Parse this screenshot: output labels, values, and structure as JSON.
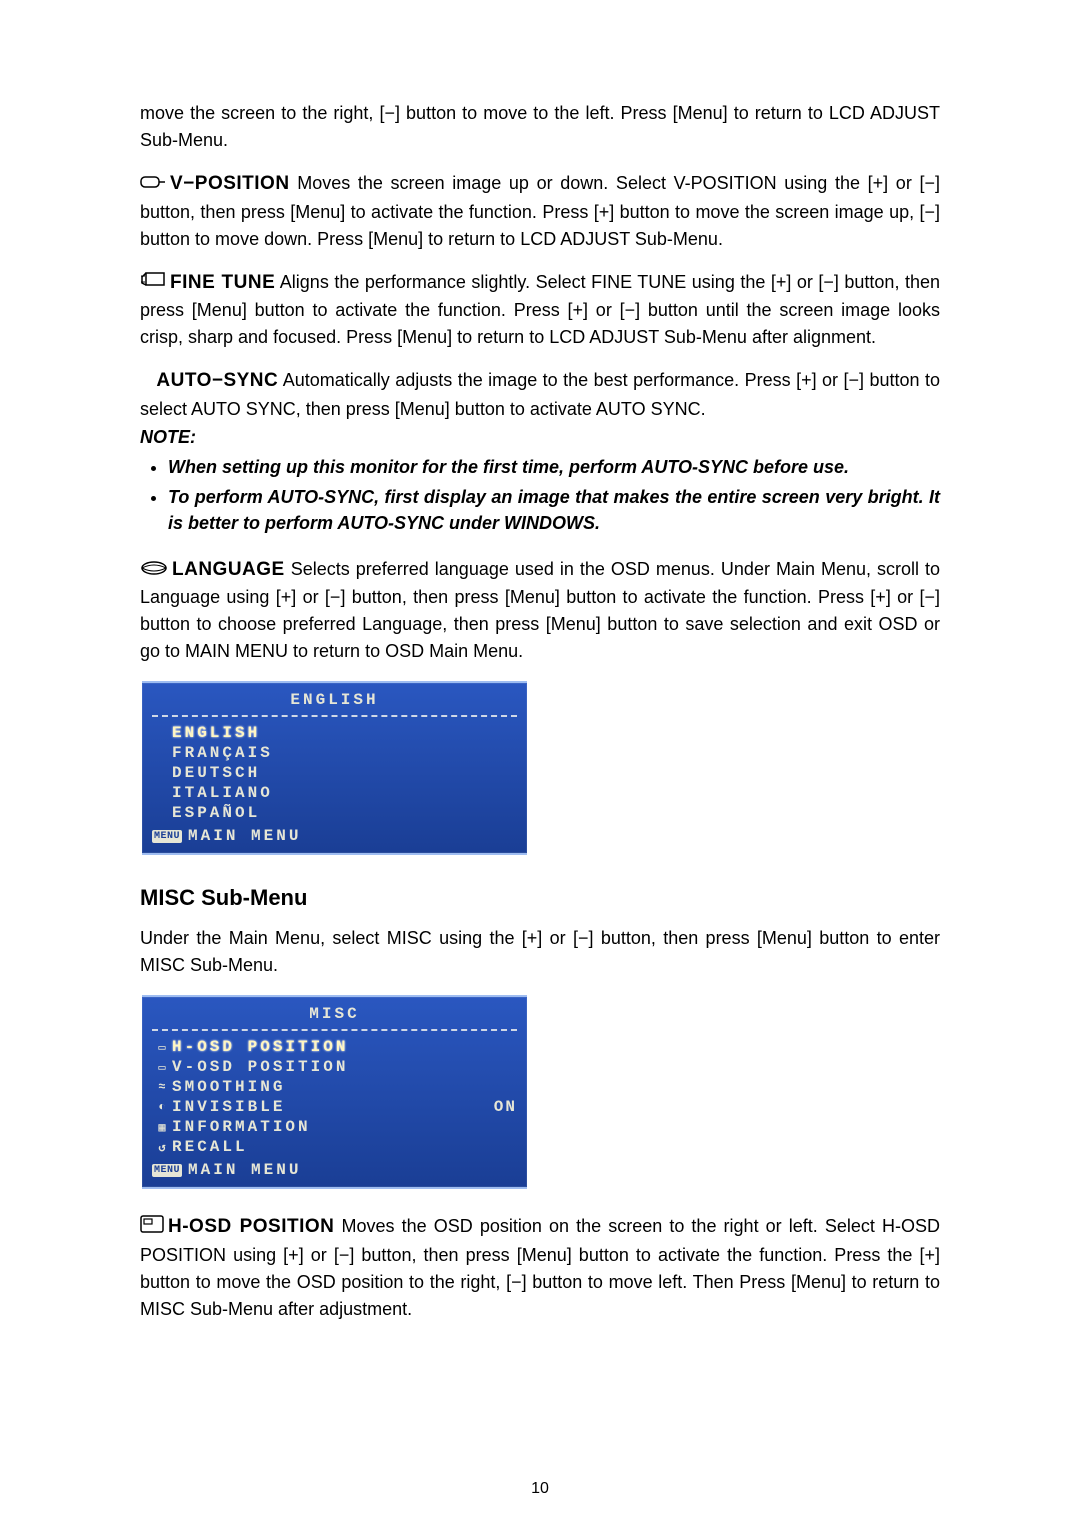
{
  "top_continuation": "move the screen to the right, [−] button to move to the left. Press [Menu] to return to LCD ADJUST Sub-Menu.",
  "vposition": {
    "title": "V−POSITION",
    "desc": "Moves the screen image up or down. Select V-POSITION using the [+] or [−] button, then press [Menu] to activate the function. Press [+] button to move the screen image up, [−] button to move down. Press [Menu] to return to LCD ADJUST Sub-Menu."
  },
  "finetune": {
    "title": "FINE TUNE",
    "desc": "Aligns the performance slightly. Select FINE TUNE using the [+] or [−] button, then press [Menu] button to activate the function. Press [+] or [−] button until the screen image looks crisp, sharp and focused. Press [Menu] to return to LCD ADJUST Sub-Menu after alignment."
  },
  "autosync": {
    "title": "AUTO−SYNC",
    "desc": "Automatically adjusts the image to the best performance. Press [+] or [−] button to select AUTO SYNC, then press [Menu] button to activate AUTO SYNC."
  },
  "note_label": "NOTE:",
  "notes": [
    "When setting up this monitor for the first time, perform AUTO-SYNC before use.",
    "To perform AUTO-SYNC, first display an image that makes the entire screen very bright. It is better to perform AUTO-SYNC under WINDOWS."
  ],
  "language": {
    "title": "LANGUAGE",
    "desc": "Selects preferred language used in the OSD menus. Under Main Menu, scroll to Language using [+] or [−] button, then press [Menu] button to activate the function. Press [+] or [−] button to choose preferred Language, then press [Menu] button to save selection and exit OSD or go to MAIN MENU to return to OSD Main Menu."
  },
  "osd_language": {
    "title": "ENGLISH",
    "options": [
      "ENGLISH",
      "FRANÇAIS",
      "DEUTSCH",
      "ITALIANO",
      "ESPAÑOL"
    ],
    "footer_tag": "MENU",
    "footer": "MAIN MENU"
  },
  "misc_heading": "MISC Sub-Menu",
  "misc_intro": "Under the Main Menu, select MISC using the [+] or [−] button, then press [Menu] button to enter MISC Sub-Menu.",
  "osd_misc": {
    "title": "MISC",
    "rows": [
      {
        "icon": "▭",
        "label": "H-OSD POSITION",
        "value": "",
        "selected": true
      },
      {
        "icon": "▭",
        "label": "V-OSD POSITION",
        "value": "",
        "selected": false
      },
      {
        "icon": "≈",
        "label": "SMOOTHING",
        "value": "",
        "selected": false
      },
      {
        "icon": "◐",
        "label": "INVISIBLE",
        "value": "ON",
        "selected": false
      },
      {
        "icon": "▦",
        "label": "INFORMATION",
        "value": "",
        "selected": false
      },
      {
        "icon": "↺",
        "label": "RECALL",
        "value": "",
        "selected": false
      }
    ],
    "footer_tag": "MENU",
    "footer": "MAIN MENU"
  },
  "hosd": {
    "title": "H-OSD POSITION",
    "desc": "Moves the OSD position on the screen to the right or left. Select H-OSD POSITION using [+] or [−] button, then press [Menu] button to activate the function. Press the [+] button to move the OSD position to the right, [−] button to move left. Then Press [Menu] to return to MISC Sub-Menu after adjustment."
  },
  "page_number": "10"
}
